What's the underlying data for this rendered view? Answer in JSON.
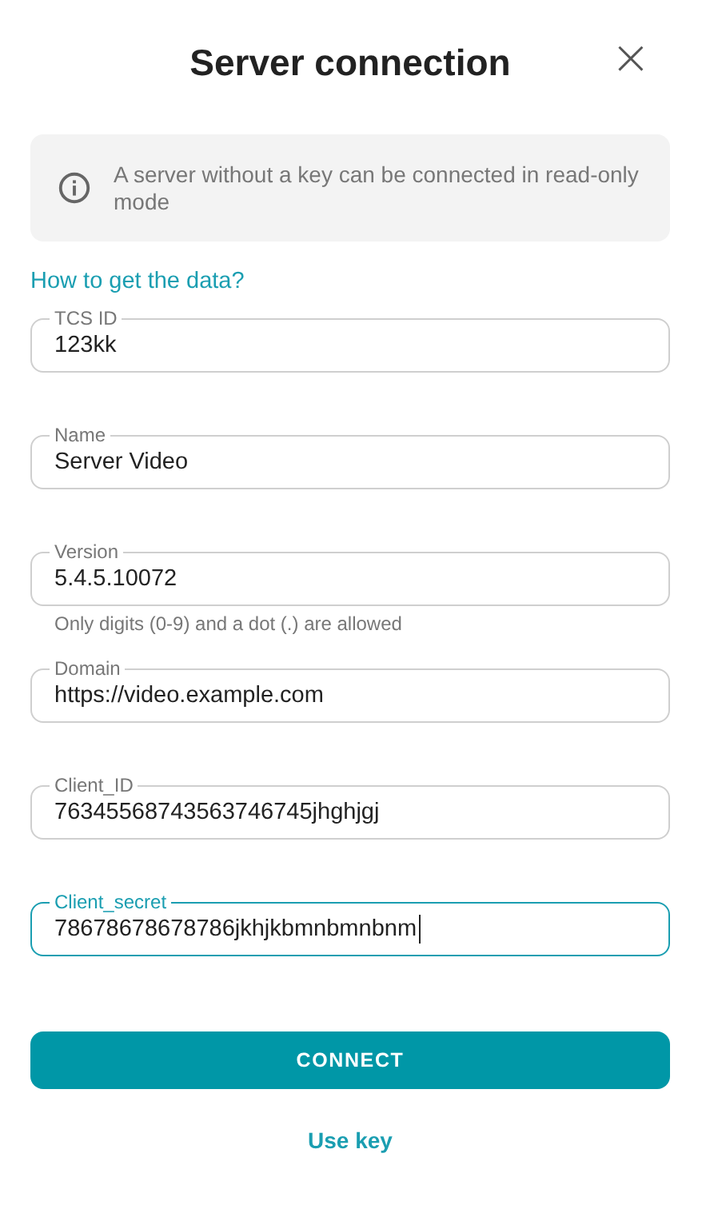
{
  "dialog": {
    "title": "Server connection",
    "close": "×"
  },
  "notice": {
    "text": "A server without a key can be connected in read-only mode"
  },
  "help_link": "How to get the data?",
  "fields": [
    {
      "label": "TCS ID",
      "value": "123kk",
      "focused": false
    },
    {
      "label": "Name",
      "value": "Server Video",
      "focused": false
    },
    {
      "label": "Version",
      "value": "5.4.5.10072",
      "focused": false,
      "helper": "Only digits (0-9) and a dot (.) are allowed"
    },
    {
      "label": "Domain",
      "value": "https://video.example.com",
      "focused": false
    },
    {
      "label": "Client_ID",
      "value": "76345568743563746745jhghjgj",
      "focused": false
    },
    {
      "label": "Client_secret",
      "value": "78678678678786jkhjkbmnbmnbnm",
      "focused": true
    }
  ],
  "connect_button": "CONNECT",
  "use_key_link": "Use key"
}
